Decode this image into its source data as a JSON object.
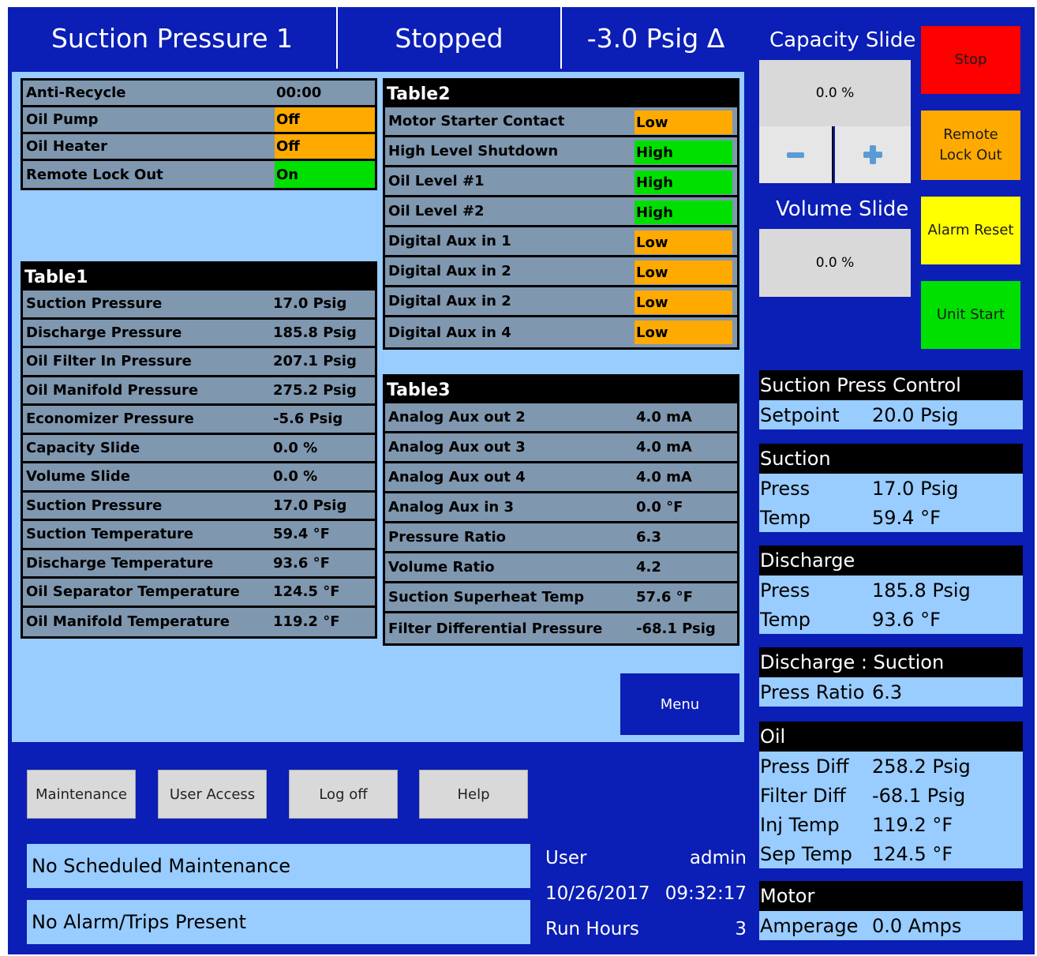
{
  "header": {
    "title": "Suction Pressure 1",
    "state": "Stopped",
    "delta": "-3.0 Psig Δ"
  },
  "status_table": [
    {
      "label": "Anti-Recycle",
      "value": "00:00",
      "color": ""
    },
    {
      "label": "Oil Pump",
      "value": "Off",
      "color": "#FFAA00"
    },
    {
      "label": "Oil Heater",
      "value": "Off",
      "color": "#FFAA00"
    },
    {
      "label": "Remote Lock Out",
      "value": "On",
      "color": "#00E000"
    }
  ],
  "table1": {
    "title": "Table1",
    "rows": [
      {
        "label": "Suction Pressure",
        "value": "17.0 Psig"
      },
      {
        "label": "Discharge Pressure",
        "value": "185.8 Psig"
      },
      {
        "label": "Oil Filter In Pressure",
        "value": "207.1 Psig"
      },
      {
        "label": "Oil Manifold Pressure",
        "value": "275.2 Psig"
      },
      {
        "label": "Economizer Pressure",
        "value": "-5.6 Psig"
      },
      {
        "label": "Capacity Slide",
        "value": "0.0 %"
      },
      {
        "label": "Volume Slide",
        "value": "0.0 %"
      },
      {
        "label": "Suction Pressure",
        "value": "17.0 Psig"
      },
      {
        "label": "Suction Temperature",
        "value": "59.4 °F"
      },
      {
        "label": "Discharge Temperature",
        "value": "93.6 °F"
      },
      {
        "label": "Oil Separator Temperature",
        "value": "124.5 °F"
      },
      {
        "label": "Oil Manifold Temperature",
        "value": "119.2 °F"
      }
    ]
  },
  "table2": {
    "title": "Table2",
    "rows": [
      {
        "label": "Motor Starter Contact",
        "value": "Low",
        "color": "#FFAA00"
      },
      {
        "label": "High Level Shutdown",
        "value": "High",
        "color": "#00E000"
      },
      {
        "label": "Oil Level #1",
        "value": "High",
        "color": "#00E000"
      },
      {
        "label": "Oil Level #2",
        "value": "High",
        "color": "#00E000"
      },
      {
        "label": "Digital Aux in 1",
        "value": "Low",
        "color": "#FFAA00"
      },
      {
        "label": "Digital Aux in 2",
        "value": "Low",
        "color": "#FFAA00"
      },
      {
        "label": "Digital Aux in 2",
        "value": "Low",
        "color": "#FFAA00"
      },
      {
        "label": "Digital Aux in 4",
        "value": "Low",
        "color": "#FFAA00"
      }
    ]
  },
  "table3": {
    "title": "Table3",
    "rows": [
      {
        "label": "Analog Aux out 2",
        "value": "4.0 mA"
      },
      {
        "label": "Analog Aux out 3",
        "value": "4.0 mA"
      },
      {
        "label": "Analog Aux out 4",
        "value": "4.0 mA"
      },
      {
        "label": "Analog Aux in 3",
        "value": "0.0 °F"
      },
      {
        "label": "Pressure Ratio",
        "value": "6.3"
      },
      {
        "label": "Volume Ratio",
        "value": "4.2"
      },
      {
        "label": "Suction Superheat Temp",
        "value": "57.6 °F"
      },
      {
        "label": "Filter Differential Pressure",
        "value": "-68.1 Psig"
      }
    ]
  },
  "menu_label": "Menu",
  "capacity_slide": {
    "label": "Capacity Slide",
    "value": "0.0 %",
    "minus": "−",
    "plus": "+"
  },
  "volume_slide": {
    "label": "Volume Slide",
    "value": "0.0 %"
  },
  "side_buttons": {
    "stop": "Stop",
    "remote_lockout_1": "Remote",
    "remote_lockout_2": "Lock Out",
    "alarm_reset": "Alarm Reset",
    "unit_start": "Unit Start"
  },
  "colors": {
    "stop": "#FF0000",
    "remote": "#FFAA00",
    "alarm": "#FFFF00",
    "start": "#00E000",
    "frame": "#0B1EB5",
    "panel": "#99CCFF"
  },
  "right_panel": {
    "spc": {
      "title": "Suction Press Control",
      "rows": [
        {
          "k": "Setpoint",
          "v": "20.0 Psig"
        }
      ]
    },
    "suction": {
      "title": "Suction",
      "rows": [
        {
          "k": "Press",
          "v": "17.0 Psig"
        },
        {
          "k": "Temp",
          "v": "59.4 °F"
        }
      ]
    },
    "discharge": {
      "title": "Discharge",
      "rows": [
        {
          "k": "Press",
          "v": "185.8 Psig"
        },
        {
          "k": "Temp",
          "v": "93.6 °F"
        }
      ]
    },
    "ratio": {
      "title": "Discharge : Suction",
      "rows": [
        {
          "k": "Press Ratio",
          "v": "6.3"
        }
      ]
    },
    "oil": {
      "title": "Oil",
      "rows": [
        {
          "k": "Press Diff",
          "v": "258.2 Psig"
        },
        {
          "k": "Filter Diff",
          "v": "-68.1 Psig"
        },
        {
          "k": "Inj Temp",
          "v": "119.2 °F"
        },
        {
          "k": "Sep Temp",
          "v": "124.5 °F"
        }
      ]
    },
    "motor": {
      "title": "Motor",
      "rows": [
        {
          "k": "Amperage",
          "v": "0.0 Amps"
        }
      ]
    }
  },
  "bottom_buttons": {
    "maintenance": "Maintenance",
    "user_access": "User Access",
    "log_off": "Log off",
    "help": "Help"
  },
  "messages": {
    "maintenance": "No Scheduled Maintenance",
    "alarms": "No Alarm/Trips Present"
  },
  "info": {
    "user_label": "User",
    "user_value": "admin",
    "date": "10/26/2017",
    "time": "09:32:17",
    "run_hours_label": "Run Hours",
    "run_hours_value": "3"
  }
}
